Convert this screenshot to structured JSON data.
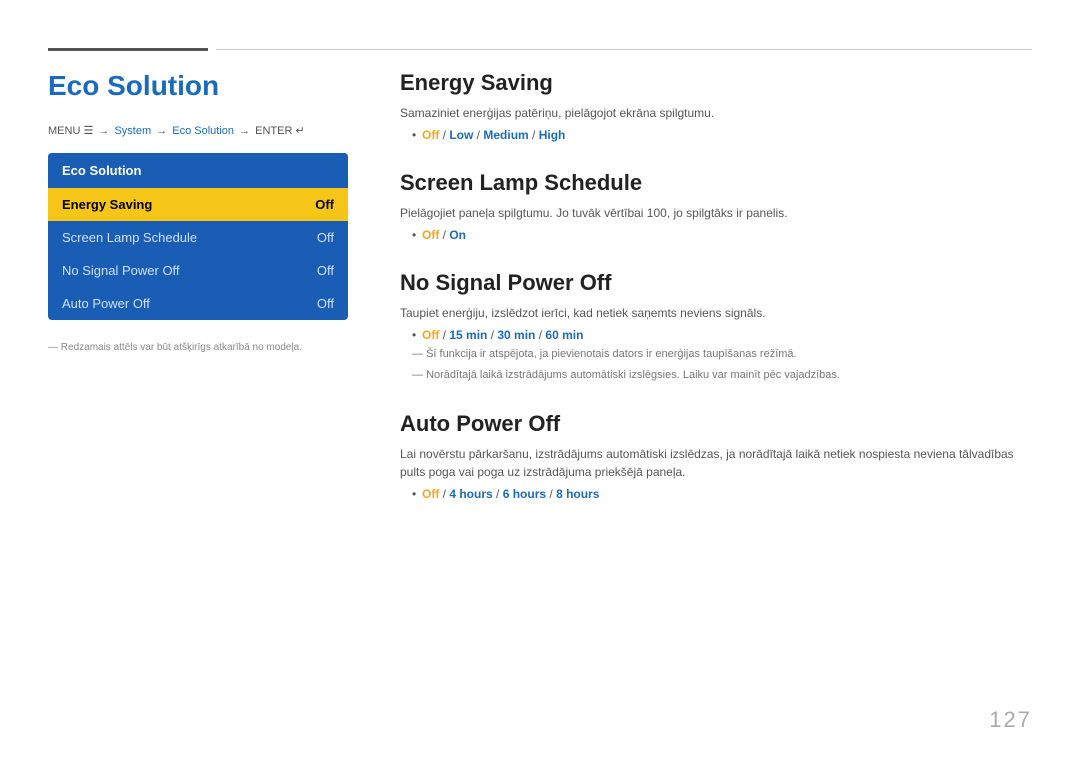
{
  "page": {
    "number": "127"
  },
  "topLines": {
    "shortLine": true,
    "longLine": true
  },
  "leftCol": {
    "title": "Eco Solution",
    "breadcrumb": {
      "menu": "MENU",
      "arrow1": "→",
      "system": "System",
      "arrow2": "→",
      "ecoSolution": "Eco Solution",
      "arrow3": "→",
      "enter": "ENTER"
    },
    "menuBox": {
      "title": "Eco Solution",
      "items": [
        {
          "label": "Energy Saving",
          "value": "Off",
          "active": true
        },
        {
          "label": "Screen Lamp Schedule",
          "value": "Off",
          "active": false
        },
        {
          "label": "No Signal Power Off",
          "value": "Off",
          "active": false
        },
        {
          "label": "Auto Power Off",
          "value": "Off",
          "active": false
        }
      ]
    },
    "footnote": "Redzamais attēls var būt atšķirīgs atkarībā no modeļa."
  },
  "rightCol": {
    "sections": [
      {
        "id": "energy-saving",
        "title": "Energy Saving",
        "desc": "Samaziniet enerģijas patēriņu, pielāgojot ekrāna spilgtumu.",
        "options": "Off / Low / Medium / High",
        "optionParts": [
          {
            "text": "Off",
            "style": "off"
          },
          {
            "text": " / ",
            "style": "normal"
          },
          {
            "text": "Low",
            "style": "blue"
          },
          {
            "text": " / ",
            "style": "normal"
          },
          {
            "text": "Medium",
            "style": "blue"
          },
          {
            "text": " / ",
            "style": "normal"
          },
          {
            "text": "High",
            "style": "blue"
          }
        ],
        "notes": []
      },
      {
        "id": "screen-lamp",
        "title": "Screen Lamp Schedule",
        "desc": "Pielāgojiet paneļa spilgtumu. Jo tuvāk vērtībai 100, jo spilgtāks ir panelis.",
        "optionParts": [
          {
            "text": "Off",
            "style": "off"
          },
          {
            "text": " / ",
            "style": "normal"
          },
          {
            "text": "On",
            "style": "blue"
          }
        ],
        "notes": []
      },
      {
        "id": "no-signal",
        "title": "No Signal Power Off",
        "desc": "Taupiet enerģiju, izslēdzot ierīci, kad netiek saņemts neviens signāls.",
        "optionParts": [
          {
            "text": "Off",
            "style": "off"
          },
          {
            "text": " / ",
            "style": "normal"
          },
          {
            "text": "15 min",
            "style": "blue"
          },
          {
            "text": " / ",
            "style": "normal"
          },
          {
            "text": "30 min",
            "style": "blue"
          },
          {
            "text": " / ",
            "style": "normal"
          },
          {
            "text": "60 min",
            "style": "blue"
          }
        ],
        "notes": [
          "Šī funkcija ir atspējota, ja pievienotais dators ir enerģijas taupīšanas režīmā.",
          "Norādītajā laikā izstrādājums automātiski izslēgsies. Laiku var mainīt pēc vajadzības."
        ]
      },
      {
        "id": "auto-power",
        "title": "Auto Power Off",
        "desc": "Lai novērstu pārkaršanu, izstrādājums automātiski izslēdzas, ja norādītajā laikā netiek nospiesta neviena tālvadības pults poga vai poga uz izstrādājuma priekšējā paneļa.",
        "optionParts": [
          {
            "text": "Off",
            "style": "off"
          },
          {
            "text": " / ",
            "style": "normal"
          },
          {
            "text": "4 hours",
            "style": "blue"
          },
          {
            "text": " / ",
            "style": "normal"
          },
          {
            "text": "6 hours",
            "style": "blue"
          },
          {
            "text": " / ",
            "style": "normal"
          },
          {
            "text": "8 hours",
            "style": "blue"
          }
        ],
        "notes": []
      }
    ]
  }
}
